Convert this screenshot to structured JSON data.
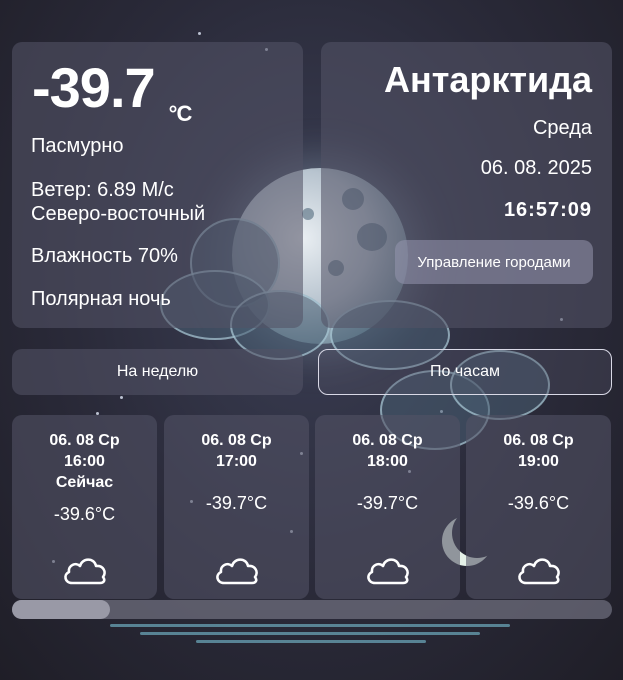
{
  "current": {
    "temperature": "-39.7",
    "unit": "°C",
    "condition": "Пасмурно",
    "wind_speed": "Ветер: 6.89 М/с",
    "wind_direction": "Северо-восточный",
    "humidity": "Влажность 70%",
    "phenomenon": "Полярная ночь"
  },
  "location": {
    "city": "Антарктида",
    "weekday": "Среда",
    "date": "06. 08. 2025",
    "time": "16:57:09",
    "manage_button": "Управление городами"
  },
  "tabs": {
    "week": "На неделю",
    "hourly": "По часам"
  },
  "hourly": [
    {
      "date": "06. 08 Ср",
      "time": "16:00",
      "now": "Сейчас",
      "temp": "-39.6°C",
      "icon": "cloud-icon"
    },
    {
      "date": "06. 08 Ср",
      "time": "17:00",
      "now": "",
      "temp": "-39.7°C",
      "icon": "cloud-icon"
    },
    {
      "date": "06. 08 Ср",
      "time": "18:00",
      "now": "",
      "temp": "-39.7°C",
      "icon": "cloud-icon"
    },
    {
      "date": "06. 08 Ср",
      "time": "19:00",
      "now": "",
      "temp": "-39.6°C",
      "icon": "cloud-icon"
    }
  ],
  "colors": {
    "card_bg": "#525266",
    "tab_border": "#d9d9e6",
    "text": "#ffffff"
  }
}
